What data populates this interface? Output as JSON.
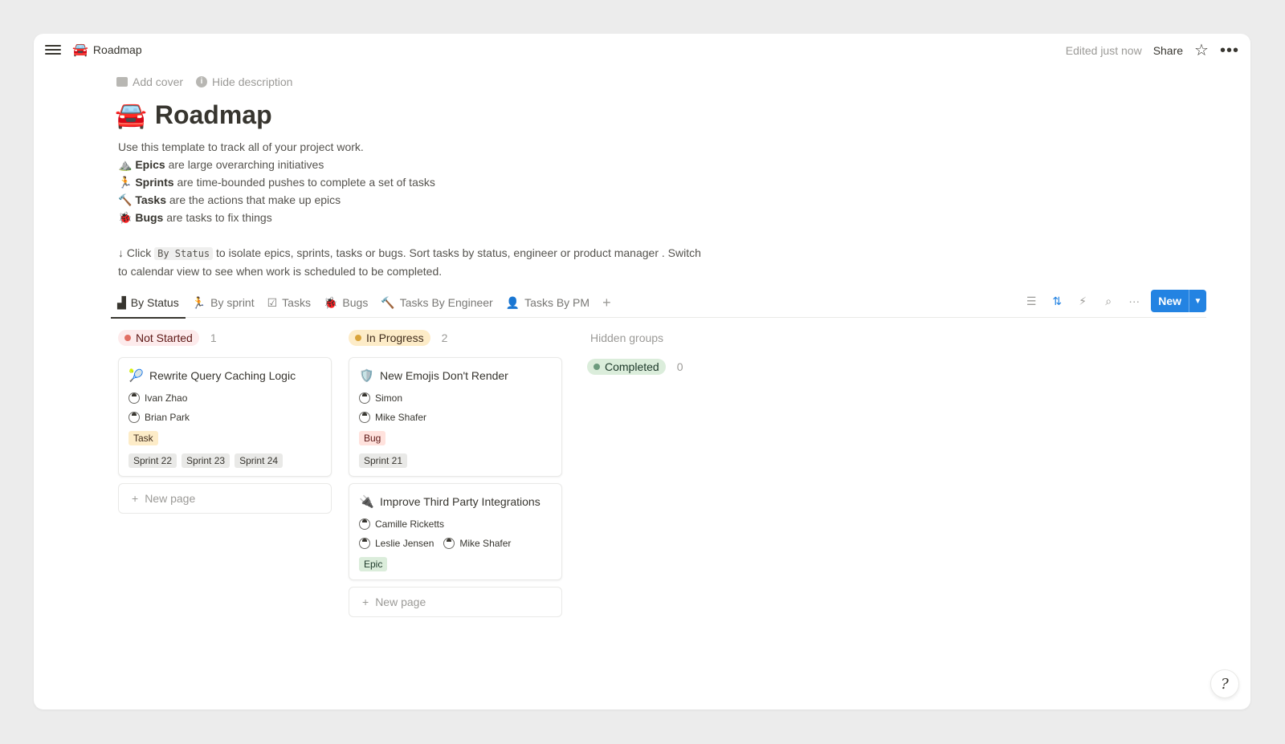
{
  "topbar": {
    "breadcrumb_emoji": "🚘",
    "breadcrumb_title": "Roadmap",
    "edited": "Edited just now",
    "share": "Share"
  },
  "page": {
    "add_cover": "Add cover",
    "hide_description": "Hide description",
    "title_emoji": "🚘",
    "title": "Roadmap",
    "intro": "Use this template to track all of your project work.",
    "bullets": [
      {
        "emoji": "⛰️",
        "bold": "Epics",
        "text": " are large overarching initiatives"
      },
      {
        "emoji": "🏃",
        "bold": "Sprints",
        "text": " are time-bounded pushes to complete a set of tasks"
      },
      {
        "emoji": "🔨",
        "bold": "Tasks",
        "text": " are the actions that make up epics"
      },
      {
        "emoji": "🐞",
        "bold": "Bugs",
        "text": " are tasks to fix things"
      }
    ],
    "instr_pre": "↓ Click ",
    "instr_code": "By Status",
    "instr_post": " to isolate epics, sprints, tasks or bugs. Sort tasks by status, engineer or product manager . Switch",
    "instr_line2": "to calendar view to see when work is scheduled to be completed."
  },
  "views": {
    "tabs": [
      {
        "icon": "▟",
        "label": "By Status"
      },
      {
        "icon": "🏃",
        "label": "By sprint"
      },
      {
        "icon": "☑",
        "label": "Tasks"
      },
      {
        "icon": "🐞",
        "label": "Bugs"
      },
      {
        "icon": "🔨",
        "label": "Tasks By Engineer"
      },
      {
        "icon": "👤",
        "label": "Tasks By PM"
      }
    ],
    "new_label": "New"
  },
  "board": {
    "columns": [
      {
        "status": "Not Started",
        "count": "1",
        "cards": [
          {
            "emoji": "🎾",
            "title": "Rewrite Query Caching Logic",
            "row1": [
              "Ivan Zhao"
            ],
            "row2": [
              "Brian Park"
            ],
            "type": "Task",
            "sprints": [
              "Sprint 22",
              "Sprint 23",
              "Sprint 24"
            ]
          }
        ],
        "new_page": "New page"
      },
      {
        "status": "In Progress",
        "count": "2",
        "cards": [
          {
            "emoji": "🛡️",
            "title": "New Emojis Don't Render",
            "row1": [
              "Simon"
            ],
            "row2": [
              "Mike Shafer"
            ],
            "type": "Bug",
            "sprints": [
              "Sprint 21"
            ]
          },
          {
            "emoji": "🔌",
            "title": "Improve Third Party Integrations",
            "row1": [
              "Camille Ricketts"
            ],
            "row2": [
              "Leslie Jensen",
              "Mike Shafer"
            ],
            "type": "Epic",
            "sprints": []
          }
        ],
        "new_page": "New page"
      }
    ],
    "hidden_label": "Hidden groups",
    "hidden_status": "Completed",
    "hidden_count": "0"
  },
  "colors": {
    "accent": "#2383e2",
    "not_started_bg": "#fdebec",
    "not_started_dot": "#e16f64",
    "not_started_text": "#5d1715",
    "in_progress_bg": "#fdecc8",
    "in_progress_dot": "#d9a33a",
    "in_progress_text": "#402c1b",
    "completed_bg": "#dbeddb",
    "completed_dot": "#6c9b7d",
    "completed_text": "#1c3829",
    "task_bg": "#fdecc8",
    "bug_bg": "#ffe2dd",
    "epic_bg": "#dbeddb",
    "sprint_bg": "#e9e9e7"
  }
}
